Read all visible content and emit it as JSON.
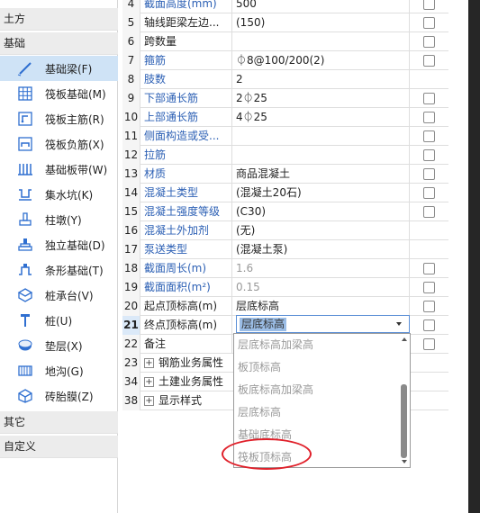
{
  "left_panel": {
    "category_top": "土方",
    "category_base": "基础",
    "category_other": "其它",
    "category_custom": "自定义",
    "items": [
      {
        "label": "基础梁(F)",
        "icon": "beam-icon",
        "selected": true
      },
      {
        "label": "筏板基础(M)",
        "icon": "raft-grid-icon",
        "selected": false
      },
      {
        "label": "筏板主筋(R)",
        "icon": "raft-main-rebar-icon",
        "selected": false
      },
      {
        "label": "筏板负筋(X)",
        "icon": "raft-negative-rebar-icon",
        "selected": false
      },
      {
        "label": "基础板带(W)",
        "icon": "slab-strip-icon",
        "selected": false
      },
      {
        "label": "集水坑(K)",
        "icon": "sump-pit-icon",
        "selected": false
      },
      {
        "label": "柱墩(Y)",
        "icon": "column-pier-icon",
        "selected": false
      },
      {
        "label": "独立基础(D)",
        "icon": "isolated-footing-icon",
        "selected": false
      },
      {
        "label": "条形基础(T)",
        "icon": "strip-footing-icon",
        "selected": false
      },
      {
        "label": "桩承台(V)",
        "icon": "pile-cap-icon",
        "selected": false
      },
      {
        "label": "桩(U)",
        "icon": "pile-icon",
        "selected": false
      },
      {
        "label": "垫层(X)",
        "icon": "cushion-layer-icon",
        "selected": false
      },
      {
        "label": "地沟(G)",
        "icon": "trench-icon",
        "selected": false
      },
      {
        "label": "砖胎膜(Z)",
        "icon": "brick-mold-icon",
        "selected": false
      }
    ]
  },
  "grid": {
    "rows": [
      {
        "num": "4",
        "name": "截面高度(mm)",
        "value": "500",
        "blue": true,
        "gray": false,
        "check": true
      },
      {
        "num": "5",
        "name": "轴线距梁左边...",
        "value": "(150)",
        "blue": false,
        "gray": false,
        "check": true
      },
      {
        "num": "6",
        "name": "跨数量",
        "value": "",
        "blue": false,
        "gray": false,
        "check": true
      },
      {
        "num": "7",
        "name": "箍筋",
        "value": "⏀8@100/200(2)",
        "blue": true,
        "gray": false,
        "check": true
      },
      {
        "num": "8",
        "name": "肢数",
        "value": "2",
        "blue": true,
        "gray": false,
        "check": false
      },
      {
        "num": "9",
        "name": "下部通长筋",
        "value": "2⏀25",
        "blue": true,
        "gray": false,
        "check": true
      },
      {
        "num": "10",
        "name": "上部通长筋",
        "value": "4⏀25",
        "blue": true,
        "gray": false,
        "check": true
      },
      {
        "num": "11",
        "name": "侧面构造或受...",
        "value": "",
        "blue": true,
        "gray": false,
        "check": true
      },
      {
        "num": "12",
        "name": "拉筋",
        "value": "",
        "blue": true,
        "gray": false,
        "check": true
      },
      {
        "num": "13",
        "name": "材质",
        "value": "商品混凝土",
        "blue": true,
        "gray": false,
        "check": true
      },
      {
        "num": "14",
        "name": "混凝土类型",
        "value": "(混凝土20石)",
        "blue": true,
        "gray": false,
        "check": true
      },
      {
        "num": "15",
        "name": "混凝土强度等级",
        "value": "(C30)",
        "blue": true,
        "gray": false,
        "check": true
      },
      {
        "num": "16",
        "name": "混凝土外加剂",
        "value": "(无)",
        "blue": true,
        "gray": false,
        "check": false
      },
      {
        "num": "17",
        "name": "泵送类型",
        "value": "(混凝土泵)",
        "blue": true,
        "gray": false,
        "check": false
      },
      {
        "num": "18",
        "name": "截面周长(m)",
        "value": "1.6",
        "blue": true,
        "gray": true,
        "check": true
      },
      {
        "num": "19",
        "name": "截面面积(m²)",
        "value": "0.15",
        "blue": true,
        "gray": true,
        "check": true
      },
      {
        "num": "20",
        "name": "起点顶标高(m)",
        "value": "层底标高",
        "blue": false,
        "gray": false,
        "check": true
      },
      {
        "num": "21",
        "name": "终点顶标高(m)",
        "value": "",
        "blue": false,
        "gray": false,
        "check": true
      },
      {
        "num": "22",
        "name": "备注",
        "value": "",
        "blue": false,
        "gray": false,
        "check": true
      },
      {
        "num": "23",
        "name": "钢筋业务属性",
        "value": "",
        "blue": false,
        "gray": false,
        "check": false,
        "group": true
      },
      {
        "num": "34",
        "name": "土建业务属性",
        "value": "",
        "blue": false,
        "gray": false,
        "check": false,
        "group": true
      },
      {
        "num": "38",
        "name": "显示样式",
        "value": "",
        "blue": false,
        "gray": false,
        "check": false,
        "group": true
      }
    ],
    "expander_symbol": "+"
  },
  "combo": {
    "current_value": "层底标高"
  },
  "dropdown": {
    "options": [
      "层底标高加梁高",
      "板顶标高",
      "板底标高加梁高",
      "层底标高",
      "基础底标高",
      "筏板顶标高"
    ],
    "highlighted_option": "筏板顶标高"
  },
  "colors": {
    "selected_item_bg": "#cfe3f6",
    "property_blue": "#2b5fb4",
    "annotation_red": "#e0202a"
  }
}
